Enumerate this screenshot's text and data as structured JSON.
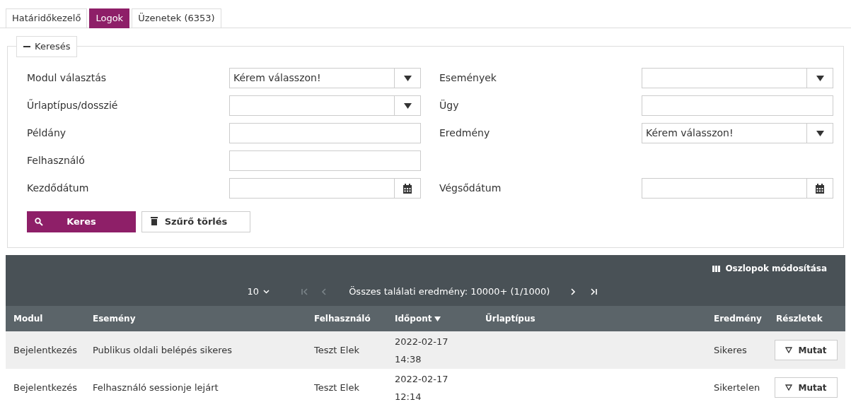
{
  "tabs": [
    {
      "label": "Határidőkezelő",
      "selected": false
    },
    {
      "label": "Logok",
      "selected": true
    },
    {
      "label": "Üzenetek (6353)",
      "selected": false
    }
  ],
  "search": {
    "legend": "Keresés",
    "expanded": true,
    "rows": [
      {
        "left": {
          "label": "Modul választás",
          "kind": "select",
          "value": "Kérem válasszon!"
        },
        "right": {
          "label": "Események",
          "kind": "select"
        }
      },
      {
        "left": {
          "label": "Űrlaptípus/dosszié",
          "kind": "select"
        },
        "right": {
          "label": "Ügy",
          "kind": "text"
        }
      },
      {
        "left": {
          "label": "Példány",
          "kind": "text"
        },
        "right": {
          "label": "Eredmény",
          "kind": "select",
          "value": "Kérem válasszon!"
        }
      },
      {
        "left": {
          "label": "Felhasználó",
          "kind": "text"
        }
      },
      {
        "left": {
          "label": "Kezdődátum",
          "kind": "date"
        },
        "right": {
          "label": "Végsődátum",
          "kind": "date"
        }
      }
    ],
    "buttons": [
      {
        "label": "Keres",
        "kind": "primary"
      },
      {
        "label": "Szűrő törlés",
        "kind": "secondary"
      }
    ]
  },
  "table": {
    "columns_button": "Oszlopok módosítása",
    "pager": {
      "page_size": "10",
      "summary": "Összes találati eredmény: 10000+ (1/1000)",
      "nav": [
        {
          "kind": "first",
          "disabled": true
        },
        {
          "kind": "prev",
          "disabled": true
        },
        {
          "kind": "next",
          "disabled": false
        },
        {
          "kind": "last",
          "disabled": false
        }
      ]
    },
    "columns": [
      {
        "label": "Modul",
        "sorted": false
      },
      {
        "label": "Esemény",
        "sorted": false
      },
      {
        "label": "Felhasználó",
        "sorted": false
      },
      {
        "label": "Időpont",
        "sorted": true
      },
      {
        "label": "Űrlaptípus",
        "sorted": false
      },
      {
        "label": "Eredmény",
        "sorted": false
      },
      {
        "label": "Részletek",
        "sorted": false
      }
    ],
    "rows": [
      {
        "cells": [
          "Bejelentkezés",
          "Publikus oldali belépés sikeres",
          "Teszt Elek",
          "2022-02-17 14:38",
          "",
          "Sikeres"
        ],
        "action": "Mutat"
      },
      {
        "cells": [
          "Bejelentkezés",
          "Felhasználó sessionje lejárt",
          "Teszt Elek",
          "2022-02-17 12:14",
          "",
          "Sikertelen"
        ],
        "action": "Mutat"
      }
    ]
  }
}
